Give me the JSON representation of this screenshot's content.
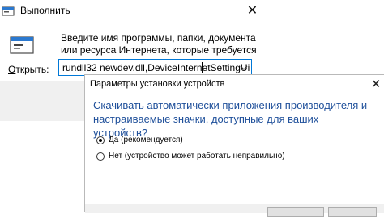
{
  "run_dialog": {
    "title": "Выполнить",
    "description": "Введите имя программы, папки, документа или ресурса Интернета, которые требуется открыть.",
    "open_label_underlined": "О",
    "open_label_rest": "ткрыть:",
    "command_value": "rundll32 newdev.dll,DeviceInternetSettingUi",
    "close_glyph": "✕"
  },
  "device_settings_dialog": {
    "title": "Параметры установки устройств",
    "question": "Скачивать автоматически приложения производителя и настраиваемые значки, доступные для ваших устройств?",
    "options": [
      {
        "label": "Да (рекомендуется)",
        "selected": true
      },
      {
        "label": "Нет (устройство может работать неправильно)",
        "selected": false
      }
    ],
    "close_glyph": "✕"
  },
  "colors": {
    "question_text": "#1e4f9a",
    "input_focus_border": "#0078d7",
    "panel_background": "#f0f0f0"
  },
  "icons": [
    "run-window-icon",
    "close-icon",
    "run-program-icon",
    "chevron-down-icon"
  ]
}
